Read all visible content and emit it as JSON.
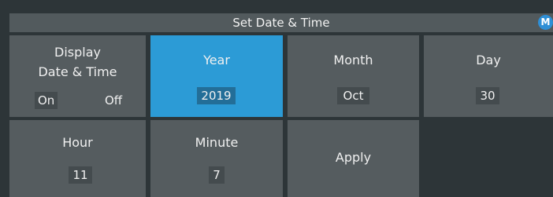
{
  "header": {
    "title": "Set Date & Time",
    "badge": "M"
  },
  "display_tile": {
    "label_line1": "Display",
    "label_line2": "Date & Time",
    "on_label": "On",
    "off_label": "Off",
    "active_option": "On"
  },
  "year": {
    "label": "Year",
    "value": "2019"
  },
  "month": {
    "label": "Month",
    "value": "Oct"
  },
  "day": {
    "label": "Day",
    "value": "30"
  },
  "hour": {
    "label": "Hour",
    "value": "11"
  },
  "minute": {
    "label": "Minute",
    "value": "7"
  },
  "apply": {
    "label": "Apply"
  },
  "colors": {
    "background": "#2d3538",
    "title_bar": "#525a5d",
    "tile": "#555c5f",
    "selected_tile": "#2c9bd6",
    "value_box": "#444b4e",
    "badge": "#2e8fd6"
  }
}
